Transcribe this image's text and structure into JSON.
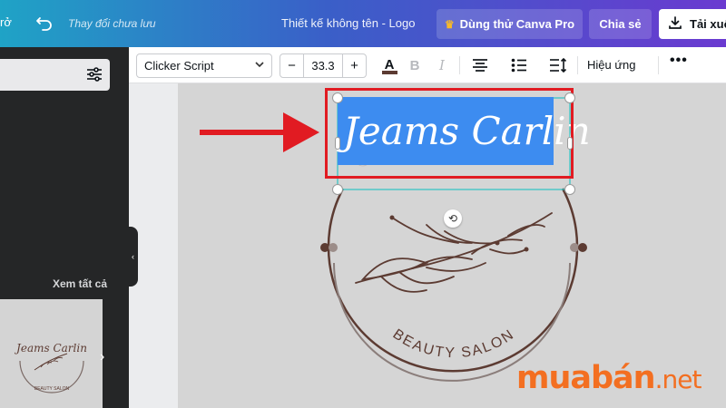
{
  "topbar": {
    "left_text": "rở",
    "unsaved_status": "Thay đổi chưa lưu",
    "doc_title": "Thiết kế không tên - Logo",
    "pro_button": "Dùng thử Canva Pro",
    "share_button": "Chia sẻ",
    "download_button": "Tải xuố"
  },
  "sidepanel": {
    "see_all": "Xem tất cả",
    "thumb_title": "Jeams Carlin",
    "thumb_subtitle": "BEAUTY SALON"
  },
  "toolbar": {
    "font_name": "Clicker Script",
    "font_size": "33.3",
    "minus": "−",
    "plus": "+",
    "color_letter": "A",
    "bold": "B",
    "italic": "I",
    "effects": "Hiệu ứng",
    "more": "•••"
  },
  "canvas": {
    "logo_title": "Jeams Carlin",
    "logo_subtitle": "BEAUTY SALON",
    "text_color": "#ffffff",
    "selection_color": "#3d8cf0",
    "logo_color": "#5c3b32"
  },
  "watermark": {
    "brand": "muabán",
    "tld": ".net"
  },
  "colors": {
    "accent_red": "#e11b22",
    "brand_orange": "#f36f21"
  }
}
